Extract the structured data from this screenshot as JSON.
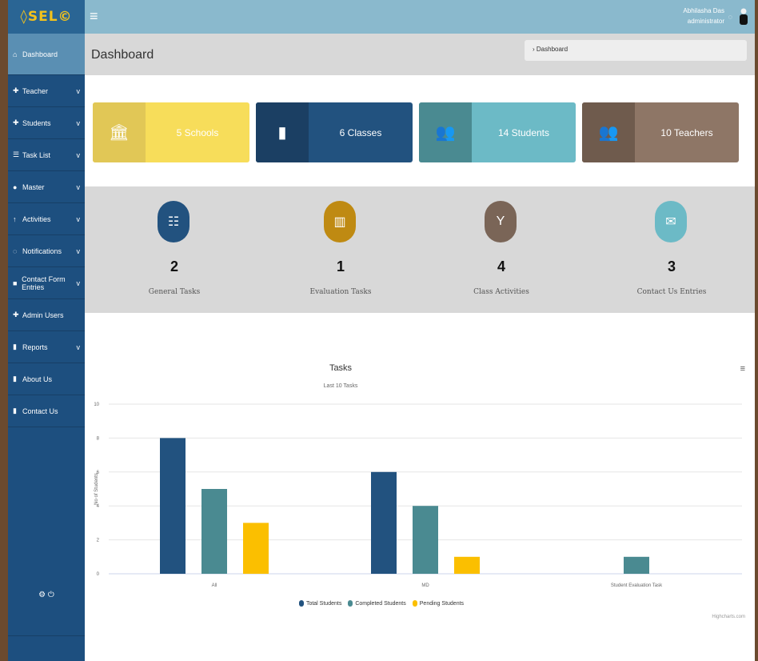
{
  "brand": {
    "logo_text": "SEL"
  },
  "sidebar": {
    "items": [
      {
        "label": "Dashboard",
        "icon": "home-icon",
        "glyph": "⌂",
        "chevron": false,
        "active": true
      },
      {
        "label": "Teacher",
        "icon": "user-group-icon",
        "glyph": "✚",
        "chevron": true
      },
      {
        "label": "Students",
        "icon": "students-icon",
        "glyph": "✚",
        "chevron": true
      },
      {
        "label": "Task List",
        "icon": "list-icon",
        "glyph": "☰",
        "chevron": true
      },
      {
        "label": "Master",
        "icon": "master-icon",
        "glyph": "●",
        "chevron": true
      },
      {
        "label": "Activities",
        "icon": "activities-icon",
        "glyph": "↑",
        "chevron": true
      },
      {
        "label": "Notifications",
        "icon": "bell-icon",
        "glyph": "◌",
        "chevron": true
      },
      {
        "label": "Contact Form Entries",
        "icon": "form-icon",
        "glyph": "■",
        "chevron": true
      },
      {
        "label": "Admin Users",
        "icon": "admin-icon",
        "glyph": "✚",
        "chevron": false
      },
      {
        "label": "Reports",
        "icon": "reports-icon",
        "glyph": "▮",
        "chevron": true
      },
      {
        "label": "About Us",
        "icon": "about-icon",
        "glyph": "▮",
        "chevron": false
      },
      {
        "label": "Contact Us",
        "icon": "contact-icon",
        "glyph": "▮",
        "chevron": false
      }
    ],
    "chevron_glyph": "v",
    "footer_icons": "⚙  ⏻"
  },
  "topbar": {
    "menu_glyph": "≡",
    "user_name": "Abhilasha Das",
    "user_role": "administrator"
  },
  "header": {
    "title": "Dashboard",
    "breadcrumb": "› Dashboard"
  },
  "stats": [
    {
      "label": "5 Schools",
      "icon": "school-icon",
      "glyph": "🏛",
      "icon_bg": "#e1c756",
      "bg": "#f7dd5a"
    },
    {
      "label": "6 Classes",
      "icon": "suitcase-icon",
      "glyph": "▮",
      "icon_bg": "#1b3f63",
      "bg": "#22527f"
    },
    {
      "label": "14 Students",
      "icon": "students-group-icon",
      "glyph": "👥",
      "icon_bg": "#4a8a91",
      "bg": "#6cbac6"
    },
    {
      "label": "10 Teachers",
      "icon": "teachers-group-icon",
      "glyph": "👥",
      "icon_bg": "#6f5b4d",
      "bg": "#8e7666"
    }
  ],
  "tasks": [
    {
      "count": "2",
      "label": "General Tasks",
      "icon": "checklist-icon",
      "glyph": "☷",
      "color": "#22527f"
    },
    {
      "count": "1",
      "label": "Evaluation Tasks",
      "icon": "map-icon",
      "glyph": "▥",
      "color": "#bf8a12"
    },
    {
      "count": "4",
      "label": "Class Activities",
      "icon": "activity-icon",
      "glyph": "Y",
      "color": "#7a6557"
    },
    {
      "count": "3",
      "label": "Contact Us Entries",
      "icon": "envelope-icon",
      "glyph": "✉",
      "color": "#6cbac6"
    }
  ],
  "chart_menu_glyph": "≡",
  "credit": "Highcharts.com",
  "chart_data": {
    "type": "bar",
    "title": "Tasks",
    "subtitle": "Last 10 Tasks",
    "ylabel": "No of Students",
    "xlabel": "",
    "ylim": [
      0,
      10
    ],
    "yticks": [
      0,
      2,
      4,
      6,
      8,
      10
    ],
    "grid": true,
    "legend": "bottom",
    "categories": [
      "All",
      "MD",
      "Student Evaluation Task"
    ],
    "series": [
      {
        "name": "Total Students",
        "color": "#22527f",
        "values": [
          8,
          6,
          0
        ]
      },
      {
        "name": "Completed Students",
        "color": "#4a8a91",
        "values": [
          5,
          4,
          1
        ]
      },
      {
        "name": "Pending Students",
        "color": "#fbbf00",
        "values": [
          3,
          1,
          0
        ]
      }
    ]
  }
}
